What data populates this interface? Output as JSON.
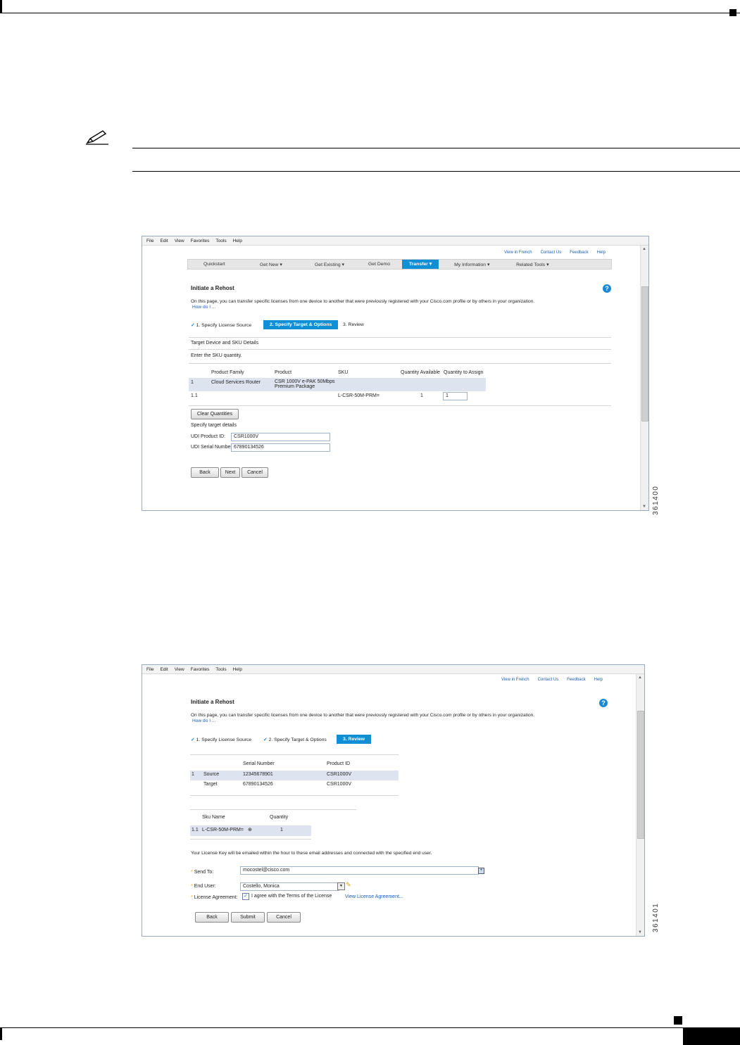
{
  "screenshot1": {
    "menu": [
      "File",
      "Edit",
      "View",
      "Favorites",
      "Tools",
      "Help"
    ],
    "top_links": [
      "View in French",
      "Contact Us",
      "Feedback",
      "Help"
    ],
    "nav": [
      "Quickstart",
      "Get New  ▾",
      "Get Existing  ▾",
      "Get Demo",
      "Transfer  ▾",
      "My Information  ▾",
      "Related Tools  ▾"
    ],
    "title": "Initiate a Rehost",
    "intro": "On this page, you can transfer specific licenses from one device to another that were previously registered with your Cisco.com profile or by others in your organization.",
    "how_do_i": "How do I ...",
    "steps": [
      "1. Specify License Source",
      "2. Specify Target & Options",
      "3. Review"
    ],
    "section": "Target Device and SKU Details",
    "enter_sku": "Enter the SKU quantity.",
    "table_headers": [
      "Product Family",
      "Product",
      "SKU",
      "Quantity Available",
      "Quantity to Assign"
    ],
    "row1": {
      "num": "1",
      "family": "Cloud Services Router",
      "product_l1": "CSR 1000V e-PAK 50Mbps",
      "product_l2": "Premium Package"
    },
    "row2": {
      "num": "1.1",
      "sku": "L-CSR-50M-PRM=",
      "available": "1",
      "assign": "1"
    },
    "clear_btn": "Clear Quantities",
    "target_details": "Specify target details",
    "udi_pid_label": "UDI Product ID:",
    "udi_pid": "CSR1000V",
    "udi_sn_label": "UDI Serial Number:",
    "udi_sn": "67890134526",
    "buttons": [
      "Back",
      "Next",
      "Cancel"
    ],
    "stamp": "361400"
  },
  "screenshot2": {
    "menu": [
      "File",
      "Edit",
      "View",
      "Favorites",
      "Tools",
      "Help"
    ],
    "top_links": [
      "View in French",
      "Contact Us",
      "Feedback",
      "Help"
    ],
    "title": "Initiate a Rehost",
    "intro": "On this page, you can transfer specific licenses from one device to another that were previously registered with your Cisco.com profile or by others in your organization.",
    "how_do_i": "How do I ...",
    "steps": [
      "1. Specify License Source",
      "2. Specify Target & Options",
      "3. Review"
    ],
    "dev_headers": [
      "Serial Number",
      "Product ID"
    ],
    "dev_rows": [
      {
        "num": "1",
        "role": "Source",
        "serial": "12345678901",
        "pid": "CSR1000V"
      },
      {
        "num": "",
        "role": "Target",
        "serial": "67890134526",
        "pid": "CSR1000V"
      }
    ],
    "sku_headers": [
      "Sku Name",
      "Quantity"
    ],
    "sku_row": {
      "num": "1.1",
      "name": "L-CSR-50M-PRM=",
      "qty": "1"
    },
    "license_note": "Your License Key will be emailed within the hour to these email addresses and connected with the specified end user.",
    "send_to_label": "Send To:",
    "send_to": "mocostel@cisco.com",
    "end_user_label": "End User:",
    "end_user": "Costello, Monica",
    "agreement_label": "License Agreement:",
    "agree_text": "I agree with the Terms of the License",
    "view_agreement": "View License Agreement...",
    "buttons": [
      "Back",
      "Submit",
      "Cancel"
    ],
    "stamp": "361401"
  }
}
